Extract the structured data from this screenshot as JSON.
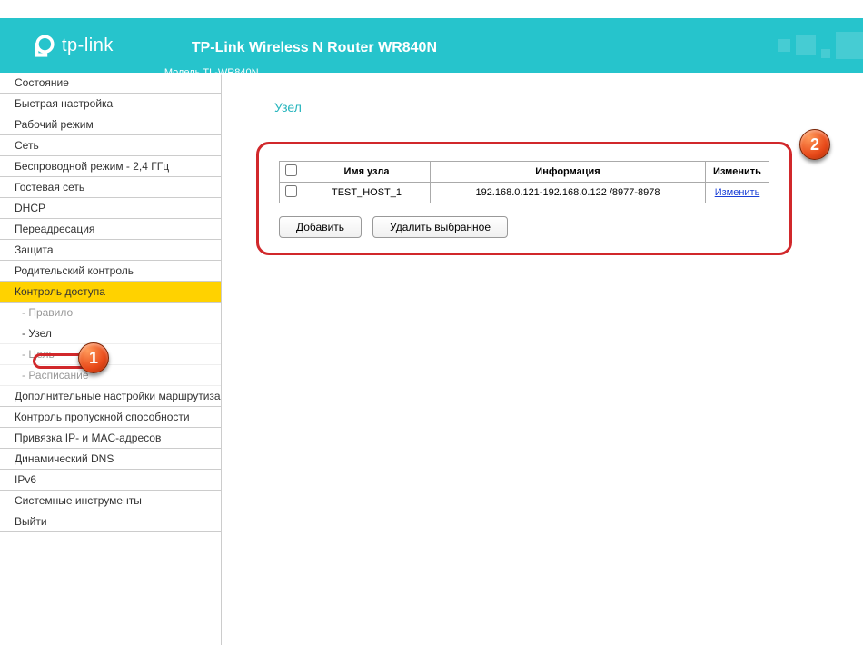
{
  "brand": "tp-link",
  "header": {
    "title": "TP-Link Wireless N Router WR840N",
    "model": "Модель TL-WR840N"
  },
  "nav": {
    "items": [
      "Состояние",
      "Быстрая настройка",
      "Рабочий режим",
      "Сеть",
      "Беспроводной режим - 2,4 ГГц",
      "Гостевая сеть",
      "DHCP",
      "Переадресация",
      "Защита",
      "Родительский контроль",
      "Контроль доступа",
      "Дополнительные настройки маршрутизации",
      "Контроль пропускной способности",
      "Привязка IP- и MAC-адресов",
      "Динамический DNS",
      "IPv6",
      "Системные инструменты",
      "Выйти"
    ],
    "subs": [
      "- Правило",
      "- Узел",
      "- Цель",
      "- Расписание"
    ]
  },
  "page": {
    "title": "Узел"
  },
  "table": {
    "headers": {
      "name": "Имя узла",
      "info": "Информация",
      "edit": "Изменить"
    },
    "rows": [
      {
        "name": "TEST_HOST_1",
        "info": "192.168.0.121-192.168.0.122 /8977-8978",
        "edit": "Изменить"
      }
    ]
  },
  "buttons": {
    "add": "Добавить",
    "delete": "Удалить выбранное"
  },
  "badges": {
    "b1": "1",
    "b2": "2"
  }
}
